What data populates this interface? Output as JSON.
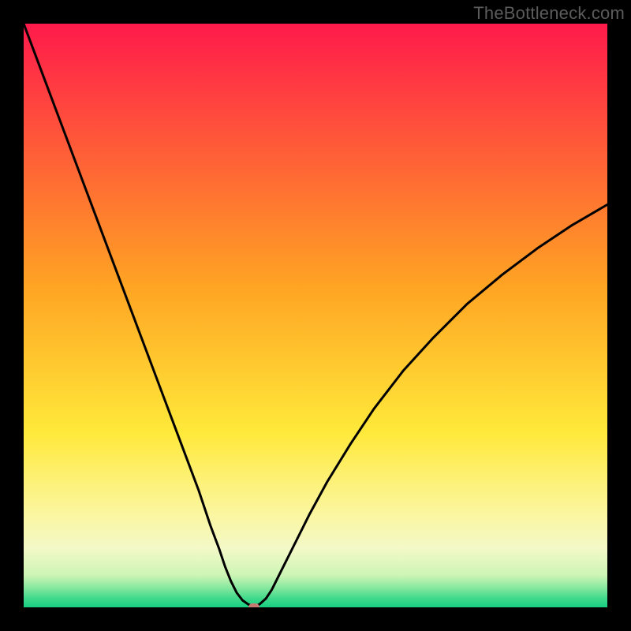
{
  "watermark": "TheBottleneck.com",
  "chart_data": {
    "type": "line",
    "title": "",
    "xlabel": "",
    "ylabel": "",
    "xlim": [
      0,
      100
    ],
    "ylim": [
      0,
      100
    ],
    "background_gradient": {
      "stops": [
        {
          "offset": 0.0,
          "color": "#ff1a4b"
        },
        {
          "offset": 0.45,
          "color": "#ffa423"
        },
        {
          "offset": 0.7,
          "color": "#ffe93a"
        },
        {
          "offset": 0.84,
          "color": "#fbf6a0"
        },
        {
          "offset": 0.9,
          "color": "#f3f9c8"
        },
        {
          "offset": 0.945,
          "color": "#cdf5b5"
        },
        {
          "offset": 0.965,
          "color": "#8ce9a0"
        },
        {
          "offset": 0.985,
          "color": "#3fd98b"
        },
        {
          "offset": 1.0,
          "color": "#17cf82"
        }
      ]
    },
    "series": [
      {
        "name": "bottleneck-curve",
        "color": "#000000",
        "x": [
          0.0,
          3.0,
          6.0,
          9.0,
          12.0,
          15.0,
          18.0,
          21.0,
          24.0,
          27.0,
          30.0,
          32.0,
          33.5,
          34.5,
          35.5,
          36.5,
          37.5,
          38.5,
          39.3,
          39.8,
          40.5,
          41.5,
          42.5,
          44.0,
          46.0,
          49.0,
          52.0,
          56.0,
          60.0,
          65.0,
          70.0,
          76.0,
          82.0,
          88.0,
          94.0,
          100.0
        ],
        "y": [
          100.0,
          92.0,
          84.0,
          76.0,
          68.0,
          60.0,
          52.0,
          44.0,
          36.0,
          28.0,
          20.0,
          14.0,
          10.0,
          7.0,
          4.5,
          2.5,
          1.2,
          0.5,
          0.2,
          0.2,
          0.6,
          1.5,
          3.0,
          6.0,
          10.0,
          16.0,
          21.5,
          28.0,
          34.0,
          40.5,
          46.0,
          52.0,
          57.0,
          61.5,
          65.5,
          69.0
        ]
      }
    ],
    "marker": {
      "x": 39.5,
      "y": 0.0,
      "color": "#c77a72"
    }
  }
}
